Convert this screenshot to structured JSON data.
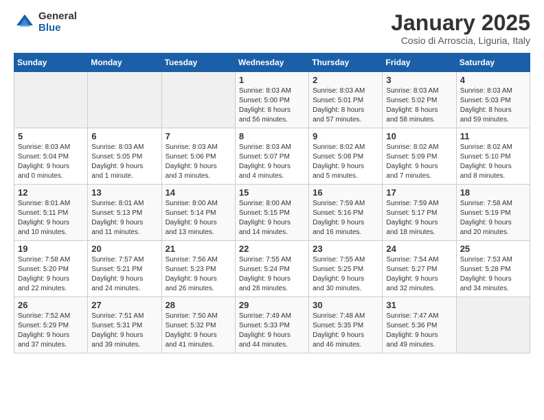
{
  "logo": {
    "general": "General",
    "blue": "Blue"
  },
  "header": {
    "month": "January 2025",
    "location": "Cosio di Arroscia, Liguria, Italy"
  },
  "weekdays": [
    "Sunday",
    "Monday",
    "Tuesday",
    "Wednesday",
    "Thursday",
    "Friday",
    "Saturday"
  ],
  "weeks": [
    [
      {
        "day": "",
        "info": ""
      },
      {
        "day": "",
        "info": ""
      },
      {
        "day": "",
        "info": ""
      },
      {
        "day": "1",
        "info": "Sunrise: 8:03 AM\nSunset: 5:00 PM\nDaylight: 8 hours\nand 56 minutes."
      },
      {
        "day": "2",
        "info": "Sunrise: 8:03 AM\nSunset: 5:01 PM\nDaylight: 8 hours\nand 57 minutes."
      },
      {
        "day": "3",
        "info": "Sunrise: 8:03 AM\nSunset: 5:02 PM\nDaylight: 8 hours\nand 58 minutes."
      },
      {
        "day": "4",
        "info": "Sunrise: 8:03 AM\nSunset: 5:03 PM\nDaylight: 8 hours\nand 59 minutes."
      }
    ],
    [
      {
        "day": "5",
        "info": "Sunrise: 8:03 AM\nSunset: 5:04 PM\nDaylight: 9 hours\nand 0 minutes."
      },
      {
        "day": "6",
        "info": "Sunrise: 8:03 AM\nSunset: 5:05 PM\nDaylight: 9 hours\nand 1 minute."
      },
      {
        "day": "7",
        "info": "Sunrise: 8:03 AM\nSunset: 5:06 PM\nDaylight: 9 hours\nand 3 minutes."
      },
      {
        "day": "8",
        "info": "Sunrise: 8:03 AM\nSunset: 5:07 PM\nDaylight: 9 hours\nand 4 minutes."
      },
      {
        "day": "9",
        "info": "Sunrise: 8:02 AM\nSunset: 5:08 PM\nDaylight: 9 hours\nand 5 minutes."
      },
      {
        "day": "10",
        "info": "Sunrise: 8:02 AM\nSunset: 5:09 PM\nDaylight: 9 hours\nand 7 minutes."
      },
      {
        "day": "11",
        "info": "Sunrise: 8:02 AM\nSunset: 5:10 PM\nDaylight: 9 hours\nand 8 minutes."
      }
    ],
    [
      {
        "day": "12",
        "info": "Sunrise: 8:01 AM\nSunset: 5:11 PM\nDaylight: 9 hours\nand 10 minutes."
      },
      {
        "day": "13",
        "info": "Sunrise: 8:01 AM\nSunset: 5:13 PM\nDaylight: 9 hours\nand 11 minutes."
      },
      {
        "day": "14",
        "info": "Sunrise: 8:00 AM\nSunset: 5:14 PM\nDaylight: 9 hours\nand 13 minutes."
      },
      {
        "day": "15",
        "info": "Sunrise: 8:00 AM\nSunset: 5:15 PM\nDaylight: 9 hours\nand 14 minutes."
      },
      {
        "day": "16",
        "info": "Sunrise: 7:59 AM\nSunset: 5:16 PM\nDaylight: 9 hours\nand 16 minutes."
      },
      {
        "day": "17",
        "info": "Sunrise: 7:59 AM\nSunset: 5:17 PM\nDaylight: 9 hours\nand 18 minutes."
      },
      {
        "day": "18",
        "info": "Sunrise: 7:58 AM\nSunset: 5:19 PM\nDaylight: 9 hours\nand 20 minutes."
      }
    ],
    [
      {
        "day": "19",
        "info": "Sunrise: 7:58 AM\nSunset: 5:20 PM\nDaylight: 9 hours\nand 22 minutes."
      },
      {
        "day": "20",
        "info": "Sunrise: 7:57 AM\nSunset: 5:21 PM\nDaylight: 9 hours\nand 24 minutes."
      },
      {
        "day": "21",
        "info": "Sunrise: 7:56 AM\nSunset: 5:23 PM\nDaylight: 9 hours\nand 26 minutes."
      },
      {
        "day": "22",
        "info": "Sunrise: 7:55 AM\nSunset: 5:24 PM\nDaylight: 9 hours\nand 28 minutes."
      },
      {
        "day": "23",
        "info": "Sunrise: 7:55 AM\nSunset: 5:25 PM\nDaylight: 9 hours\nand 30 minutes."
      },
      {
        "day": "24",
        "info": "Sunrise: 7:54 AM\nSunset: 5:27 PM\nDaylight: 9 hours\nand 32 minutes."
      },
      {
        "day": "25",
        "info": "Sunrise: 7:53 AM\nSunset: 5:28 PM\nDaylight: 9 hours\nand 34 minutes."
      }
    ],
    [
      {
        "day": "26",
        "info": "Sunrise: 7:52 AM\nSunset: 5:29 PM\nDaylight: 9 hours\nand 37 minutes."
      },
      {
        "day": "27",
        "info": "Sunrise: 7:51 AM\nSunset: 5:31 PM\nDaylight: 9 hours\nand 39 minutes."
      },
      {
        "day": "28",
        "info": "Sunrise: 7:50 AM\nSunset: 5:32 PM\nDaylight: 9 hours\nand 41 minutes."
      },
      {
        "day": "29",
        "info": "Sunrise: 7:49 AM\nSunset: 5:33 PM\nDaylight: 9 hours\nand 44 minutes."
      },
      {
        "day": "30",
        "info": "Sunrise: 7:48 AM\nSunset: 5:35 PM\nDaylight: 9 hours\nand 46 minutes."
      },
      {
        "day": "31",
        "info": "Sunrise: 7:47 AM\nSunset: 5:36 PM\nDaylight: 9 hours\nand 49 minutes."
      },
      {
        "day": "",
        "info": ""
      }
    ]
  ]
}
